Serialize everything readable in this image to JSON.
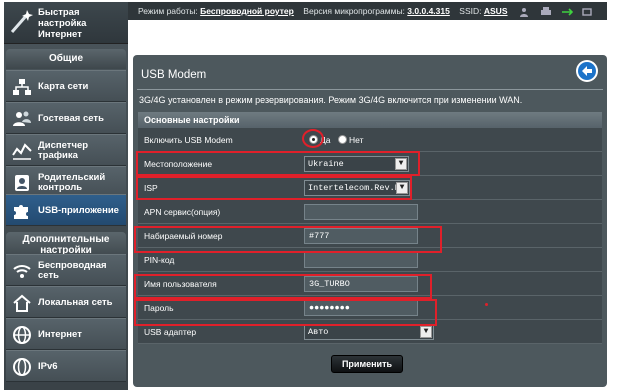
{
  "sidebar": {
    "quick_setup": "Быстрая\nнастройка\nИнтернет",
    "general_header": "Общие",
    "general_items": [
      {
        "label": "Карта сети",
        "icon": "network-map-icon"
      },
      {
        "label": "Гостевая сеть",
        "icon": "guest-network-icon"
      },
      {
        "label": "Диспетчер\nтрафика",
        "icon": "traffic-manager-icon"
      },
      {
        "label": "Родительский\nконтроль",
        "icon": "parental-control-icon"
      },
      {
        "label": "USB-приложение",
        "icon": "puzzle-icon",
        "active": true
      }
    ],
    "advanced_header": "Дополнительные\nнастройки",
    "advanced_items": [
      {
        "label": "Беспроводная\nсеть",
        "icon": "wifi-icon"
      },
      {
        "label": "Локальная сеть",
        "icon": "home-icon"
      },
      {
        "label": "Интернет",
        "icon": "globe-icon"
      },
      {
        "label": "IPv6",
        "icon": "ipv6-globe-icon"
      }
    ]
  },
  "topbar": {
    "mode_label": "Режим работы:",
    "mode_value": "Беспроводной роутер",
    "fw_label": "Версия микропрограммы:",
    "fw_value": "3.0.0.4.315",
    "ssid_label": "SSID:",
    "ssid_value": "ASUS"
  },
  "page": {
    "title": "USB Modem",
    "info": "3G/4G установлен в режим резервирования. Режим 3G/4G включится при изменении WAN.",
    "section": "Основные настройки",
    "apply": "Применить"
  },
  "form": {
    "enable_label": "Включить USB Modem",
    "yes": "Да",
    "no": "Нет",
    "enabled": "Да",
    "location_label": "Местоположение",
    "location_value": "Ukraine",
    "isp_label": "ISP",
    "isp_value": "Intertelecom.Rev.B",
    "apn_label": "APN сервис(опция)",
    "apn_value": "",
    "dial_label": "Набираемый номер",
    "dial_value": "#777",
    "pin_label": "PIN-код",
    "pin_value": "",
    "user_label": "Имя пользователя",
    "user_value": "3G_TURBO",
    "pass_label": "Пароль",
    "pass_value": "●●●●●●●●",
    "adapter_label": "USB адаптер",
    "adapter_value": "Авто"
  },
  "colors": {
    "annotation": "#e0202a",
    "active_nav": "#2f5f8c",
    "panel": "#4d585d"
  }
}
